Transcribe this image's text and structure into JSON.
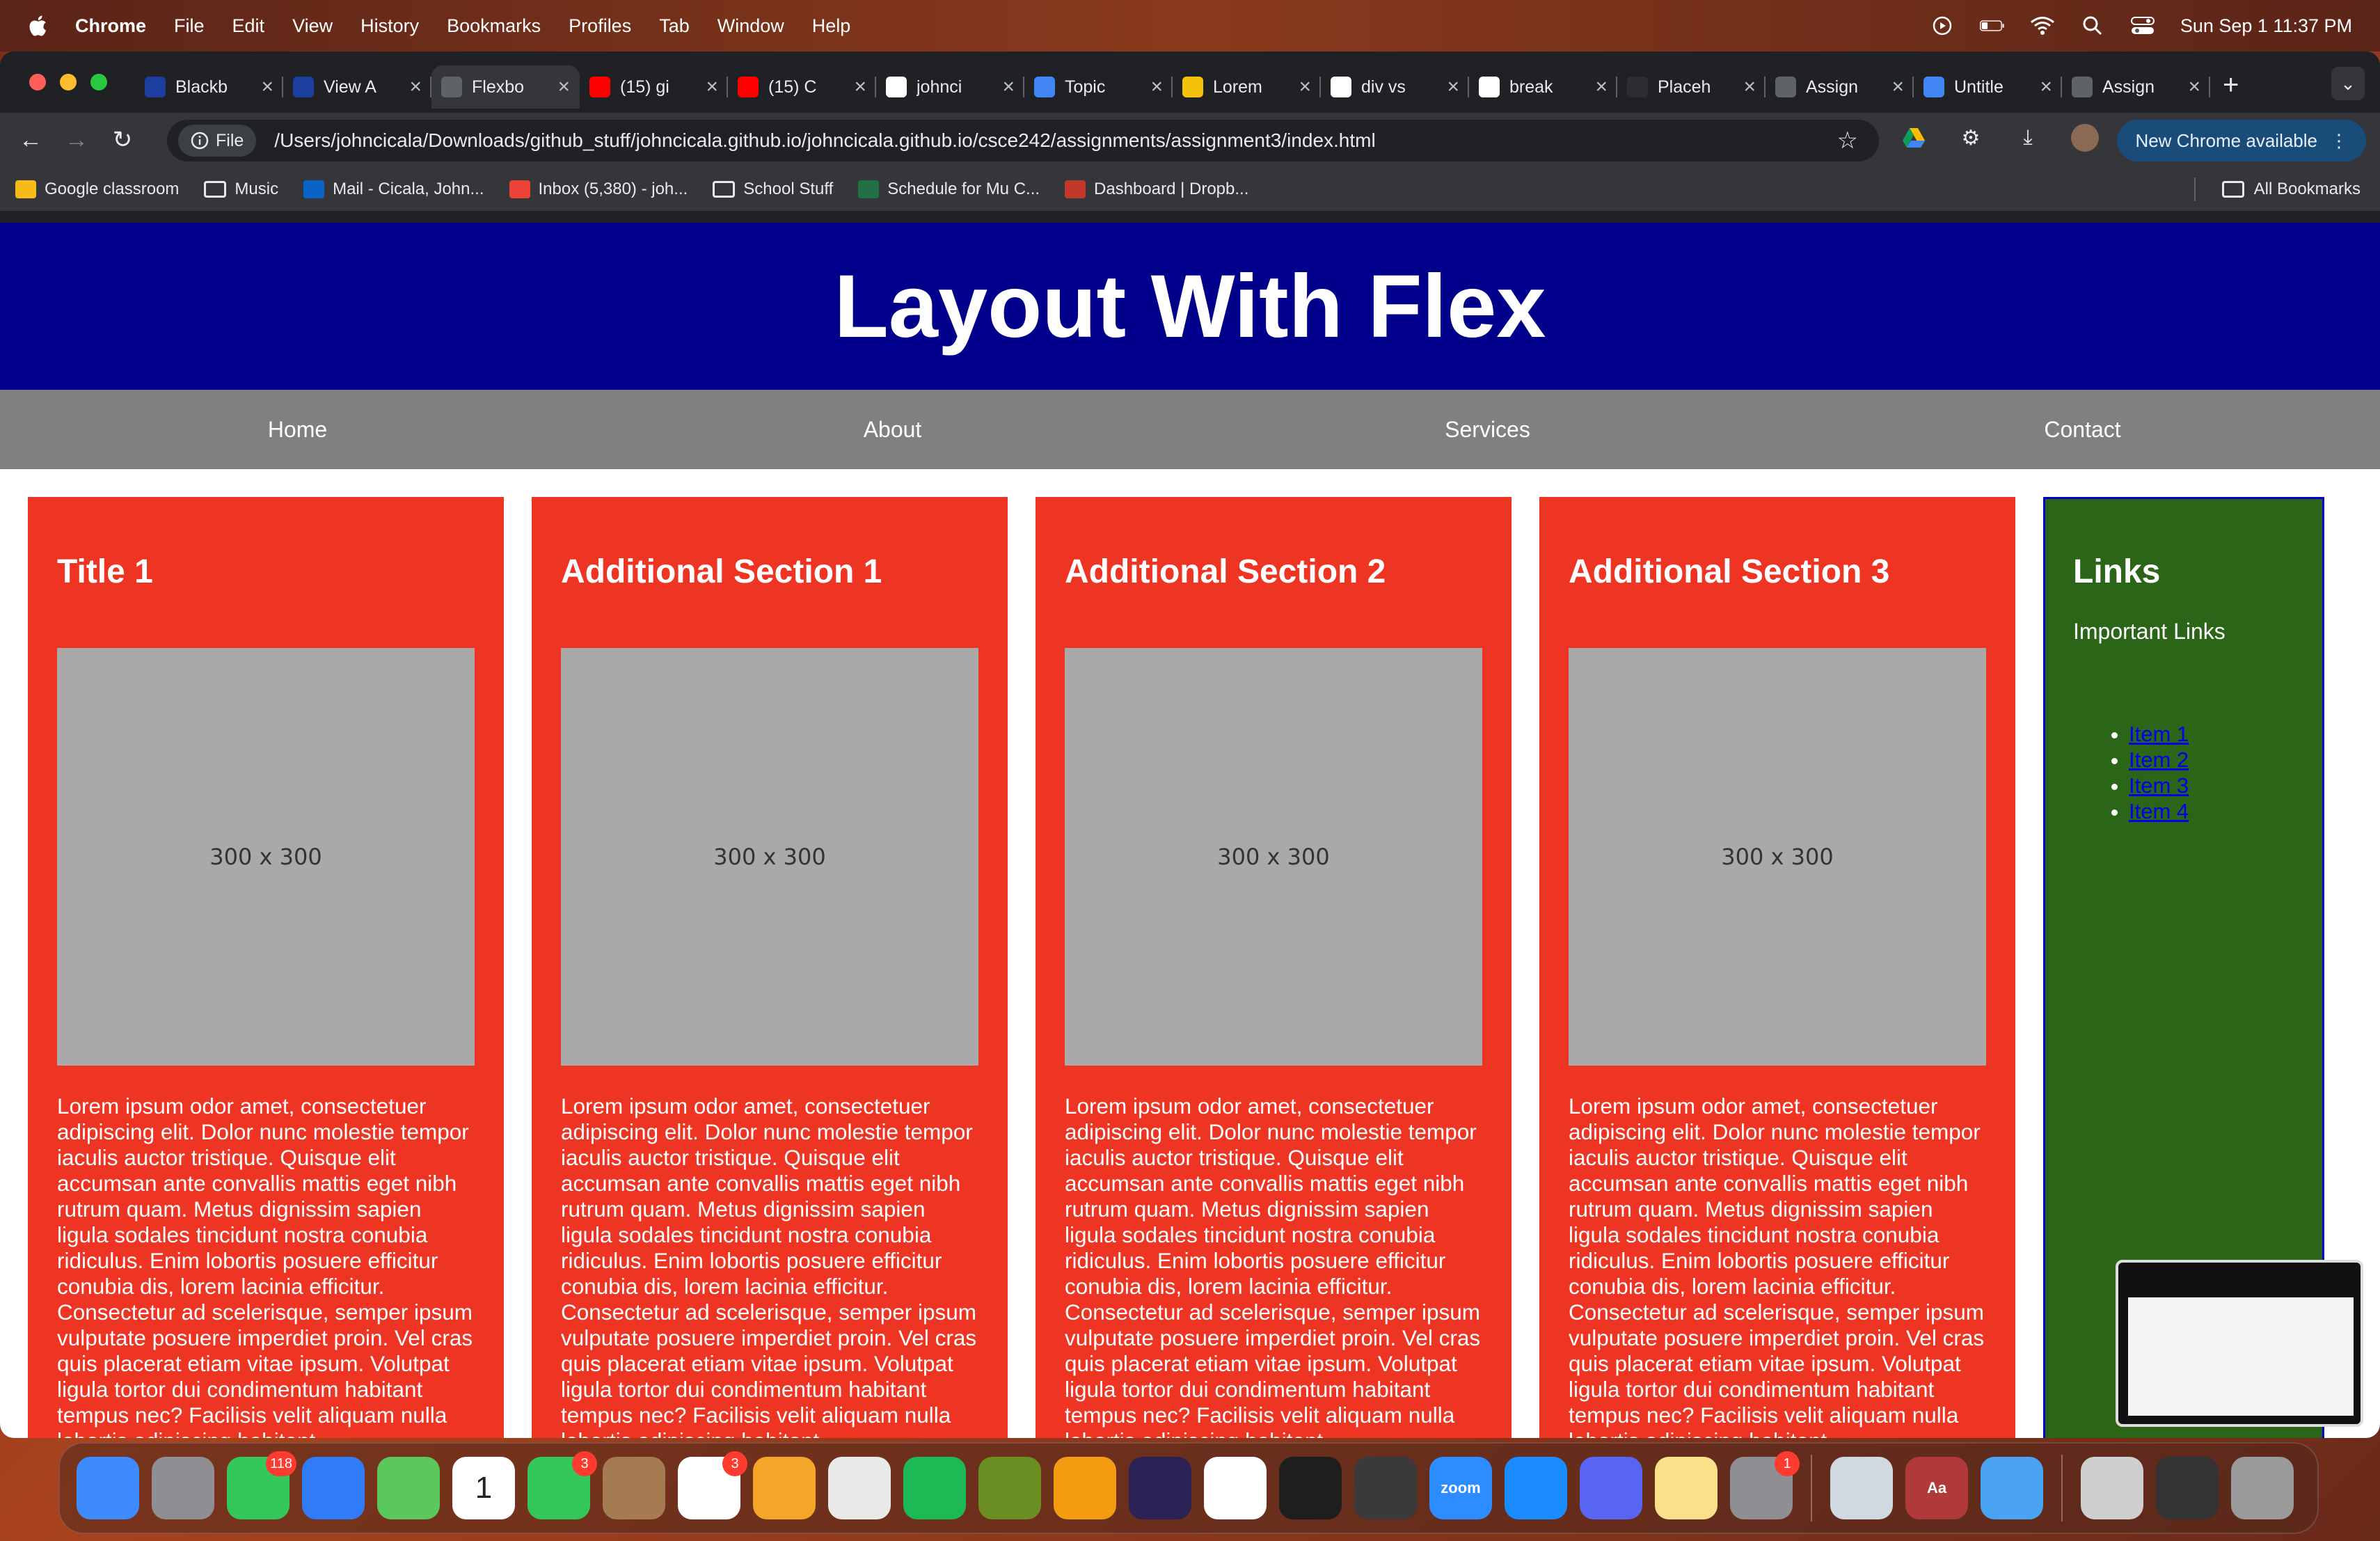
{
  "menubar": {
    "app_name": "Chrome",
    "items": [
      "File",
      "Edit",
      "View",
      "History",
      "Bookmarks",
      "Profiles",
      "Tab",
      "Window",
      "Help"
    ],
    "datetime": "Sun Sep 1  11:37 PM"
  },
  "tabs": [
    {
      "title": "Blackb",
      "icon": "blackboard-icon",
      "color": "#1c3e9e"
    },
    {
      "title": "View A",
      "icon": "blackboard-icon",
      "color": "#1c3e9e"
    },
    {
      "title": "Flexbo",
      "icon": "globe-icon",
      "color": "#5f6368",
      "active": true
    },
    {
      "title": "(15) gi",
      "icon": "youtube-icon",
      "color": "#ff0000"
    },
    {
      "title": "(15) C",
      "icon": "youtube-icon",
      "color": "#ff0000"
    },
    {
      "title": "johnci",
      "icon": "github-icon",
      "color": "#ffffff"
    },
    {
      "title": "Topic",
      "icon": "docs-icon",
      "color": "#4285f4"
    },
    {
      "title": "Lorem",
      "icon": "lorem-icon",
      "color": "#f4c20d"
    },
    {
      "title": "div vs",
      "icon": "google-icon",
      "color": "#ffffff"
    },
    {
      "title": "break",
      "icon": "google-icon",
      "color": "#ffffff"
    },
    {
      "title": "Placeh",
      "icon": "placeholder-icon",
      "color": "#2b2d31"
    },
    {
      "title": "Assign",
      "icon": "globe-icon",
      "color": "#5f6368"
    },
    {
      "title": "Untitle",
      "icon": "docs-icon",
      "color": "#4285f4"
    },
    {
      "title": "Assign",
      "icon": "globe-icon",
      "color": "#5f6368"
    }
  ],
  "toolbar": {
    "chip_label": "File",
    "url": "/Users/johncicala/Downloads/github_stuff/johncicala.github.io/johncicala.github.io/csce242/assignments/assignment3/index.html",
    "new_chrome_label": "New Chrome available"
  },
  "bookmarks": [
    {
      "label": "Google classroom",
      "icon": "classroom-icon",
      "color": "#f6bb18"
    },
    {
      "label": "Music",
      "icon": "folder-icon",
      "color": ""
    },
    {
      "label": "Mail - Cicala, John...",
      "icon": "outlook-icon",
      "color": "#0a64c8"
    },
    {
      "label": "Inbox (5,380) - joh...",
      "icon": "gmail-icon",
      "color": "#ea4335"
    },
    {
      "label": "School Stuff",
      "icon": "folder-icon",
      "color": ""
    },
    {
      "label": "Schedule for Mu C...",
      "icon": "excel-icon",
      "color": "#1f7244"
    },
    {
      "label": "Dashboard | Dropb...",
      "icon": "dropbox-icon",
      "color": "#c0392b"
    }
  ],
  "all_bookmarks_label": "All Bookmarks",
  "page": {
    "header_title": "Layout With Flex",
    "nav": [
      "Home",
      "About",
      "Services",
      "Contact"
    ],
    "cards": [
      {
        "title": "Title 1",
        "image_label": "300 x 300"
      },
      {
        "title": "Additional Section 1",
        "image_label": "300 x 300"
      },
      {
        "title": "Additional Section 2",
        "image_label": "300 x 300"
      },
      {
        "title": "Additional Section 3",
        "image_label": "300 x 300"
      }
    ],
    "body_text": "Lorem ipsum odor amet, consectetuer adipiscing elit. Dolor nunc molestie tempor iaculis auctor tristique. Quisque elit accumsan ante convallis mattis eget nibh rutrum quam. Metus dignissim sapien ligula sodales tincidunt nostra conubia ridiculus. Enim lobortis posuere efficitur conubia dis, lorem lacinia efficitur. Consectetur ad scelerisque, semper ipsum vulputate posuere imperdiet proin. Vel cras quis placerat etiam vitae ipsum. Volutpat ligula tortor dui condimentum habitant tempus nec? Facilisis velit aliquam nulla lobortis adipiscing habitant",
    "aside": {
      "title": "Links",
      "subtitle": "Important Links",
      "items": [
        "Item 1",
        "Item 2",
        "Item 3",
        "Item 4"
      ]
    },
    "colors": {
      "header": "#00008b",
      "nav": "#808080",
      "card": "#ee3524",
      "aside": "#2a6518"
    }
  },
  "dock": [
    {
      "name": "finder-icon",
      "color": "#3d8bfd"
    },
    {
      "name": "launchpad-icon",
      "color": "#8e8e93"
    },
    {
      "name": "messages-icon",
      "color": "#34c759",
      "badge": "118"
    },
    {
      "name": "mail-icon",
      "color": "#2f7cf6"
    },
    {
      "name": "maps-icon",
      "color": "#5ac85a"
    },
    {
      "name": "calendar-icon",
      "color": "#ffffff",
      "text": "1"
    },
    {
      "name": "facetime-icon",
      "color": "#34c759",
      "badge": "3"
    },
    {
      "name": "contacts-icon",
      "color": "#a57c52"
    },
    {
      "name": "reminders-icon",
      "color": "#ffffff",
      "badge": "3"
    },
    {
      "name": "photos-icon",
      "color": "#f4a62a"
    },
    {
      "name": "chrome-icon",
      "color": "#e9e9e9"
    },
    {
      "name": "spotify-icon",
      "color": "#1db954"
    },
    {
      "name": "game-icon",
      "color": "#6b8e23"
    },
    {
      "name": "pages-icon",
      "color": "#f39c12"
    },
    {
      "name": "eclipse-icon",
      "color": "#2c2255"
    },
    {
      "name": "vscode-icon",
      "color": "#ffffff"
    },
    {
      "name": "terminal-icon",
      "color": "#1e1e1e"
    },
    {
      "name": "chess-icon",
      "color": "#3a3a3a"
    },
    {
      "name": "zoom-icon",
      "color": "#2d8cff",
      "text": "zoom"
    },
    {
      "name": "appstore-icon",
      "color": "#1a8cff"
    },
    {
      "name": "discord-icon",
      "color": "#5865f2"
    },
    {
      "name": "notes-icon",
      "color": "#fbe28a"
    },
    {
      "name": "settings-icon",
      "color": "#8e8e93",
      "badge": "1"
    },
    {
      "name": "preview-icon",
      "color": "#d0d8e0"
    },
    {
      "name": "dictionary-icon",
      "color": "#b03a3a",
      "text": "Aa"
    },
    {
      "name": "weather-icon",
      "color": "#4aa3f0"
    },
    {
      "name": "downloads-stack-icon",
      "color": "#cfcfcf"
    },
    {
      "name": "recent-window-icon",
      "color": "#333333"
    },
    {
      "name": "trash-icon",
      "color": "#9a9a9a"
    }
  ]
}
